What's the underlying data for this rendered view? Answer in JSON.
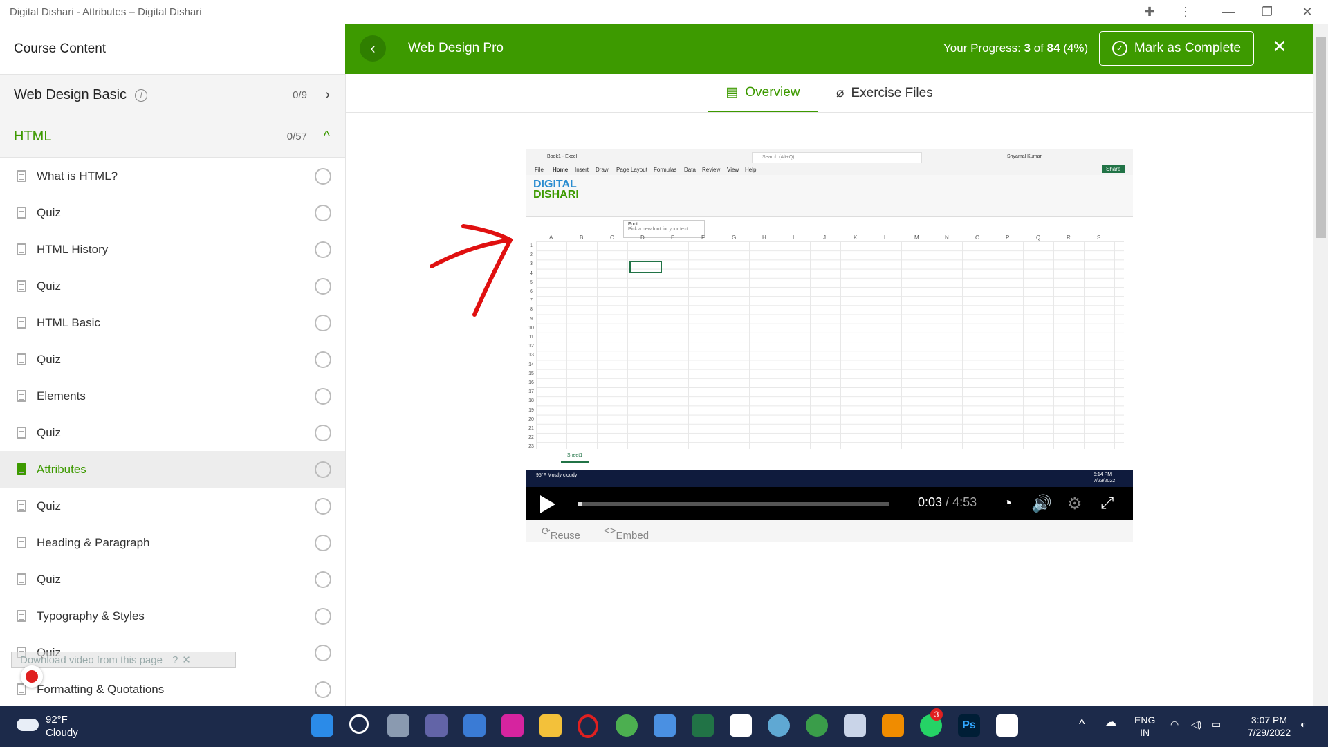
{
  "window": {
    "title": "Digital Dishari - Attributes – Digital Dishari"
  },
  "sidebar": {
    "heading": "Course Content",
    "topics": [
      {
        "name": "Web Design Basic",
        "count": "0/9"
      },
      {
        "name": "HTML",
        "count": "0/57"
      }
    ],
    "lessons": [
      {
        "label": "What is HTML?"
      },
      {
        "label": "Quiz"
      },
      {
        "label": "HTML History"
      },
      {
        "label": "Quiz"
      },
      {
        "label": "HTML Basic"
      },
      {
        "label": "Quiz"
      },
      {
        "label": "Elements"
      },
      {
        "label": "Quiz"
      },
      {
        "label": "Attributes"
      },
      {
        "label": "Quiz"
      },
      {
        "label": "Heading & Paragraph"
      },
      {
        "label": "Quiz"
      },
      {
        "label": "Typography & Styles"
      },
      {
        "label": "Quiz"
      },
      {
        "label": "Formatting & Quotations"
      }
    ],
    "download_bar": "Download video from this page"
  },
  "header": {
    "course_title": "Web Design Pro",
    "progress_prefix": "Your Progress: ",
    "progress_done": "3",
    "progress_of": " of ",
    "progress_total": "84",
    "progress_pct": " (4%)",
    "mark_complete": "Mark as Complete",
    "accent": "#3d9a00"
  },
  "tabs": {
    "overview": "Overview",
    "exercise": "Exercise Files"
  },
  "video": {
    "excel_title": "Book1 - Excel",
    "excel_search": "Search (Alt+Q)",
    "excel_user": "Shyamal Kumar",
    "excel_menu": [
      "File",
      "Home",
      "Insert",
      "Draw",
      "Page Layout",
      "Formulas",
      "Data",
      "Review",
      "View",
      "Help"
    ],
    "excel_share": "Share",
    "logo_line1": "DIGITAL",
    "logo_line2": "DISHARI",
    "font_tip_title": "Font",
    "font_tip_text": "Pick a new font for your text.",
    "columns": [
      "A",
      "B",
      "C",
      "D",
      "E",
      "F",
      "G",
      "H",
      "I",
      "J",
      "K",
      "L",
      "M",
      "N",
      "O",
      "P",
      "Q",
      "R",
      "S"
    ],
    "rows": [
      "1",
      "2",
      "3",
      "4",
      "5",
      "6",
      "7",
      "8",
      "9",
      "10",
      "11",
      "12",
      "13",
      "14",
      "15",
      "16",
      "17",
      "18",
      "19",
      "20",
      "21",
      "22",
      "23"
    ],
    "sheet_tab": "Sheet1",
    "inner_weather": "95°F Mostly cloudy",
    "inner_time": "5:14 PM",
    "inner_date": "7/23/2022",
    "current_time": "0:03",
    "duration": "4:53",
    "played_fraction": 0.01,
    "reuse": "Reuse",
    "embed": "Embed"
  },
  "taskbar": {
    "temp": "92°F",
    "condition": "Cloudy",
    "lang1": "ENG",
    "lang2": "IN",
    "time": "3:07 PM",
    "date": "7/29/2022",
    "whatsapp_badge": "3"
  }
}
